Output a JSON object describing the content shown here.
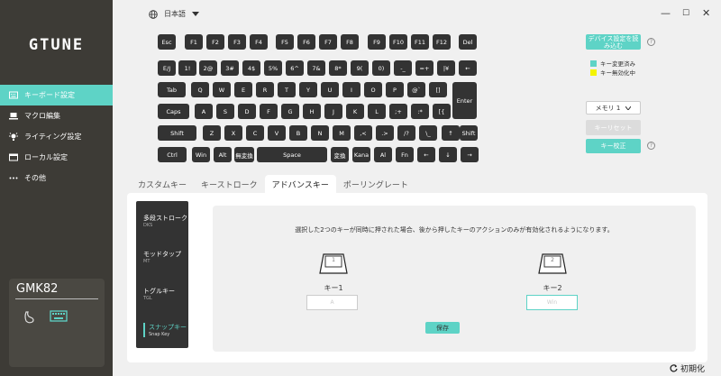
{
  "app": {
    "logo": "GTUNE"
  },
  "sidebar": {
    "items": [
      {
        "label": "キーボード設定",
        "icon": "keyboard-icon"
      },
      {
        "label": "マクロ編集",
        "icon": "laptop-icon"
      },
      {
        "label": "ライティング設定",
        "icon": "lightbulb-icon"
      },
      {
        "label": "ローカル設定",
        "icon": "folder-icon"
      },
      {
        "label": "その他",
        "icon": "more-icon"
      }
    ],
    "device": {
      "name": "GMK82"
    }
  },
  "topbar": {
    "language": "日本語"
  },
  "keyboard": {
    "rows": [
      [
        "Esc",
        "F1",
        "F2",
        "F3",
        "F4",
        "F5",
        "F6",
        "F7",
        "F8",
        "F9",
        "F10",
        "F11",
        "F12",
        "Del"
      ],
      [
        "E/J",
        "1!",
        "2@",
        "3#",
        "4$",
        "5%",
        "6^",
        "7&",
        "8*",
        "9(",
        "0)",
        "-_",
        "=+",
        "|¥",
        "←"
      ],
      [
        "Tab",
        "Q",
        "W",
        "E",
        "R",
        "T",
        "Y",
        "U",
        "I",
        "O",
        "P",
        "@`",
        "[]",
        "Enter"
      ],
      [
        "Caps",
        "A",
        "S",
        "D",
        "F",
        "G",
        "H",
        "J",
        "K",
        "L",
        ";+",
        ":*",
        "[{"
      ],
      [
        "Shift",
        "Z",
        "X",
        "C",
        "V",
        "B",
        "N",
        "M",
        ",<",
        ".>",
        "/?",
        "\\_",
        "↑",
        "Shift"
      ],
      [
        "Ctrl",
        "Win",
        "Alt",
        "無変換",
        "Space",
        "変換",
        "Kana",
        "Al",
        "Fn",
        "←",
        "↓",
        "→"
      ]
    ]
  },
  "right": {
    "load_settings": "デバイス設定を読み込む",
    "legend_changed": "キー変更済み",
    "legend_disabled": "キー無効化中",
    "memory": "メモリ 1",
    "key_reset": "キーリセット",
    "key_calibrate": "キー校正",
    "colors": {
      "changed": "#5ed3c6",
      "disabled": "#f4f400"
    }
  },
  "tabs": [
    "カスタムキー",
    "キーストローク",
    "アドバンスキー",
    "ポーリングレート"
  ],
  "active_tab": "アドバンスキー",
  "vtabs": [
    {
      "label": "多段ストローク",
      "sub": "DKS"
    },
    {
      "label": "モッドタップ",
      "sub": "MT"
    },
    {
      "label": "トグルキー",
      "sub": "TGL"
    },
    {
      "label": "スナップキー",
      "sub": "Snap Key"
    }
  ],
  "snap": {
    "description": "選択した2つのキーが同時に押された場合、後から押したキーのアクションのみが有効化されるようになります。",
    "key1_num": "1",
    "key2_num": "2",
    "key1_label": "キー1",
    "key2_label": "キー2",
    "key1_value": "A",
    "key2_value": "Win",
    "save": "保存"
  },
  "reset_label": "初期化"
}
